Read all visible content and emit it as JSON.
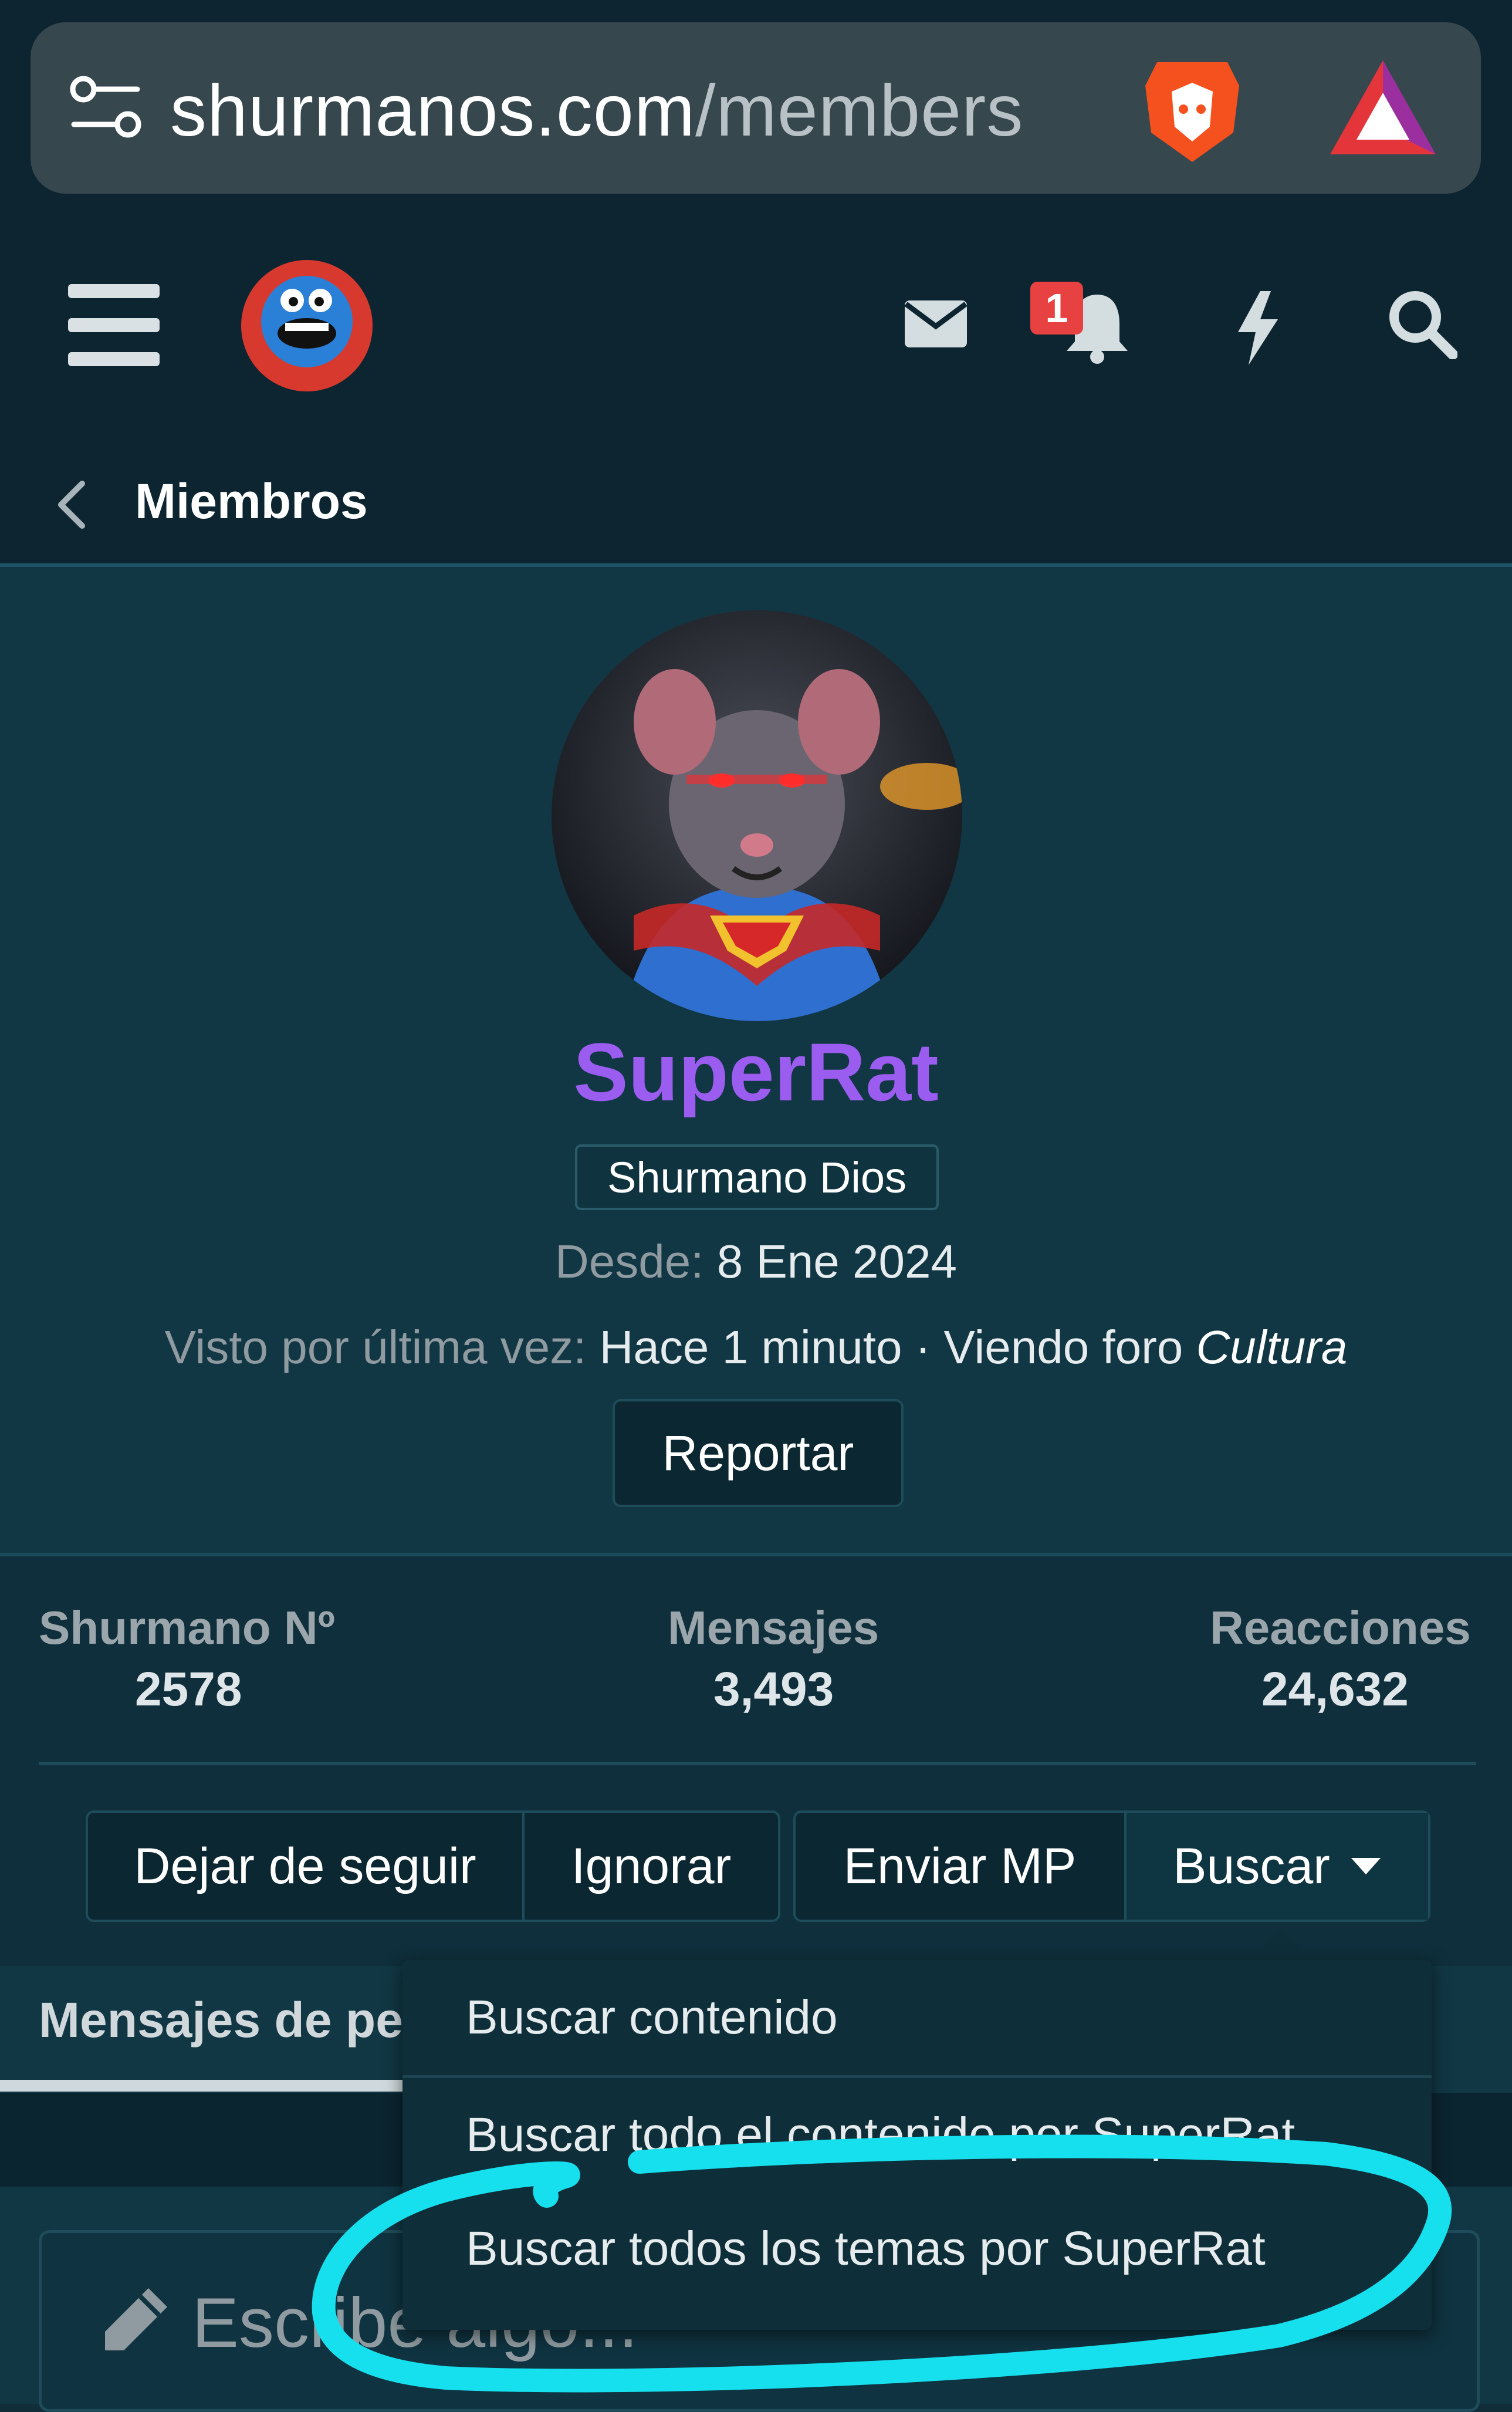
{
  "browser": {
    "url_host": "shurmanos.com",
    "url_path": "/members"
  },
  "header": {
    "notification_count": "1"
  },
  "breadcrumb": {
    "label": "Miembros"
  },
  "profile": {
    "username": "SuperRat",
    "rank": "Shurmano Dios",
    "since_label": "Desde:",
    "since_value": "8 Ene 2024",
    "last_seen_label": "Visto por última vez:",
    "last_seen_value": "Hace 1 minuto · Viendo foro",
    "last_seen_forum": "Cultura",
    "report_button": "Reportar",
    "username_color": "#9b5cf0"
  },
  "stats": [
    {
      "label": "Shurmano Nº",
      "value": "2578"
    },
    {
      "label": "Mensajes",
      "value": "3,493"
    },
    {
      "label": "Reacciones",
      "value": "24,632"
    }
  ],
  "actions": {
    "unfollow": "Dejar de seguir",
    "ignore": "Ignorar",
    "send_pm": "Enviar MP",
    "search": "Buscar"
  },
  "tabs": {
    "active": "Mensajes de pe"
  },
  "composer": {
    "placeholder": "Escribe algo..."
  },
  "dropdown": {
    "items": [
      "Buscar contenido",
      "Buscar todo el contenido por SuperRat",
      "Buscar todos los temas por SuperRat"
    ]
  },
  "annotation": {
    "color": "#16e0ee"
  }
}
